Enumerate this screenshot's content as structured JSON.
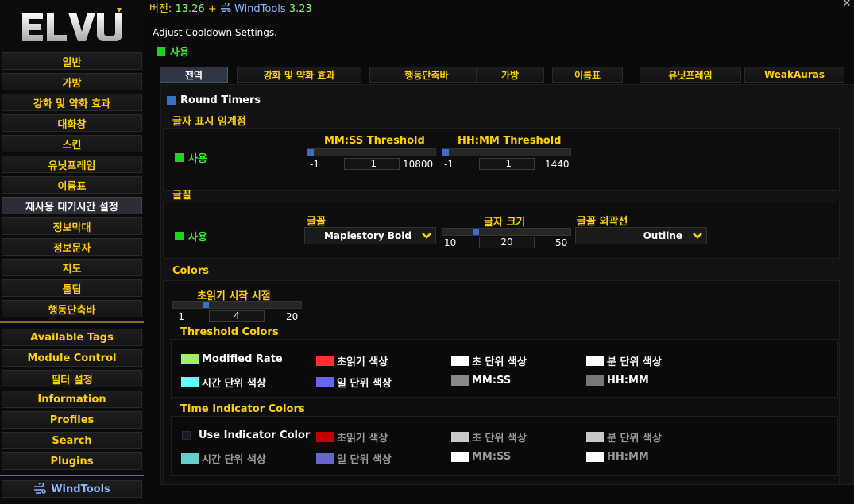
{
  "sidebar": {
    "logo_text": "ELVUI",
    "items": [
      {
        "label": "일반"
      },
      {
        "label": "가방"
      },
      {
        "label": "강화 및 약화 효과"
      },
      {
        "label": "대화창"
      },
      {
        "label": "스킨"
      },
      {
        "label": "유닛프레임"
      },
      {
        "label": "이름표"
      },
      {
        "label": "재사용 대기시간 설정"
      },
      {
        "label": "정보막대"
      },
      {
        "label": "정보문자"
      },
      {
        "label": "지도"
      },
      {
        "label": "툴팁"
      },
      {
        "label": "행동단축바"
      }
    ],
    "extra_items": [
      {
        "label": "Available Tags"
      },
      {
        "label": "Module Control"
      },
      {
        "label": "필터 설정"
      },
      {
        "label": "Information"
      },
      {
        "label": "Profiles"
      },
      {
        "label": "Search"
      },
      {
        "label": "Plugins"
      }
    ],
    "windtools_label": "WindTools"
  },
  "header": {
    "version_prefix": "버전:",
    "version": "13.26",
    "plus": "+",
    "windtools_name": "WindTools",
    "windtools_version": "3.23",
    "description": "Adjust Cooldown Settings.",
    "enable_label": "사용"
  },
  "tabs": [
    {
      "label": "전역"
    },
    {
      "label": "강화 및 약화 효과"
    },
    {
      "label": "행동단축바"
    },
    {
      "label": "가방"
    },
    {
      "label": "이름표"
    },
    {
      "label": "유닛프레임"
    },
    {
      "label": "WeakAuras"
    }
  ],
  "round_timers": {
    "label": "Round Timers"
  },
  "threshold_section": {
    "title": "글자 표시 임계점",
    "enable_label": "사용",
    "mmss": {
      "label": "MM:SS Threshold",
      "min": "-1",
      "max": "10800",
      "value": "-1",
      "fraction": 0.0
    },
    "hhmm": {
      "label": "HH:MM Threshold",
      "min": "-1",
      "max": "1440",
      "value": "-1",
      "fraction": 0.0
    }
  },
  "font_section": {
    "title": "글꼴",
    "enable_label": "사용",
    "font_label": "글꼴",
    "font_value": "Maplestory Bold",
    "size_label": "글자 크기",
    "size_min": "10",
    "size_max": "50",
    "size_value": "20",
    "size_fraction": 0.25,
    "outline_label": "글꼴 외곽선",
    "outline_value": "Outline"
  },
  "colors_section": {
    "title": "Colors",
    "expire_label": "초읽기 시작 시점",
    "expire_min": "-1",
    "expire_max": "20",
    "expire_value": "4",
    "expire_fraction": 0.24,
    "threshold_colors_title": "Threshold Colors",
    "threshold_colors": [
      {
        "label": "Modified Rate",
        "color": "#a0f060"
      },
      {
        "label": "초읽기 색상",
        "color": "#ff3030"
      },
      {
        "label": "초 단위 색상",
        "color": "#ffffff"
      },
      {
        "label": "분 단위 색상",
        "color": "#ffffff"
      },
      {
        "label": "시간 단위 색상",
        "color": "#66ffff"
      },
      {
        "label": "일 단위 색상",
        "color": "#6666ff"
      },
      {
        "label": "MM:SS",
        "color": "#888888"
      },
      {
        "label": "HH:MM",
        "color": "#777777"
      }
    ],
    "time_indicator_title": "Time Indicator Colors",
    "use_indicator_label": "Use Indicator Color",
    "time_indicator_colors": [
      {
        "label": "초읽기 색상",
        "color": "#c00000"
      },
      {
        "label": "초 단위 색상",
        "color": "#c8c8c8"
      },
      {
        "label": "분 단위 색상",
        "color": "#c8c8c8"
      },
      {
        "label": "시간 단위 색상",
        "color": "#66cccc"
      },
      {
        "label": "일 단위 색상",
        "color": "#6666cc"
      },
      {
        "label": "MM:SS",
        "color": "#ffffff"
      },
      {
        "label": "HH:MM",
        "color": "#ffffff"
      }
    ]
  }
}
